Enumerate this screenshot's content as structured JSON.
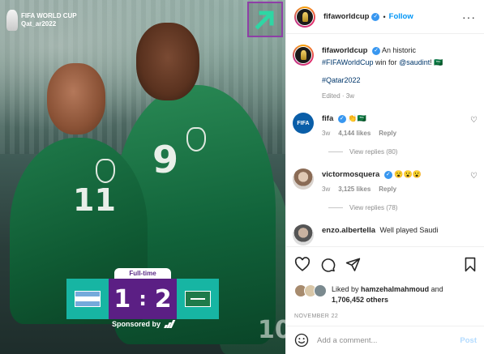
{
  "media": {
    "overlay_logo": {
      "line1": "FIFA WORLD CUP",
      "line2": "Qat_ar2022"
    },
    "full_time_label": "Full-time",
    "score_left": "1",
    "score_right": "2",
    "sponsor_label": "Sponsored by",
    "corner_icon": "arrow-up-right-icon",
    "jersey_numbers": [
      "11",
      "9",
      "10"
    ],
    "colors": {
      "score_teal": "#17b5a3",
      "score_purple": "#5b1f84",
      "jersey_green": "#11633a"
    }
  },
  "header": {
    "username": "fifaworldcup",
    "follow_label": "Follow",
    "more_icon": "more-options-icon"
  },
  "caption": {
    "username": "fifaworldcup",
    "text": "An historic",
    "hashtag_worldcup": "#FIFAWorldCup",
    "text_mid": "win for",
    "mention": "@saudint",
    "text_end": "! 🇸🇦",
    "hashtag_qatar": "#Qatar2022",
    "meta": "Edited · 3w"
  },
  "comments": [
    {
      "username": "fifa",
      "text": "👏🇸🇦",
      "time": "3w",
      "likes": "4,144 likes",
      "reply": "Reply",
      "view_replies": "View replies (80)"
    },
    {
      "username": "victormosquera",
      "text": "😮😮😮",
      "time": "3w",
      "likes": "3,125 likes",
      "reply": "Reply",
      "view_replies": "View replies (78)"
    },
    {
      "username": "enzo.albertella",
      "text": "Well played Saudi"
    }
  ],
  "actions": {
    "liked_by_prefix": "Liked by",
    "liked_by_user": "hamzehalmahmoud",
    "liked_by_and": "and",
    "liked_by_count": "1,706,452 others",
    "date": "NOVEMBER 22"
  },
  "add_comment": {
    "placeholder": "Add a comment...",
    "post_label": "Post"
  }
}
